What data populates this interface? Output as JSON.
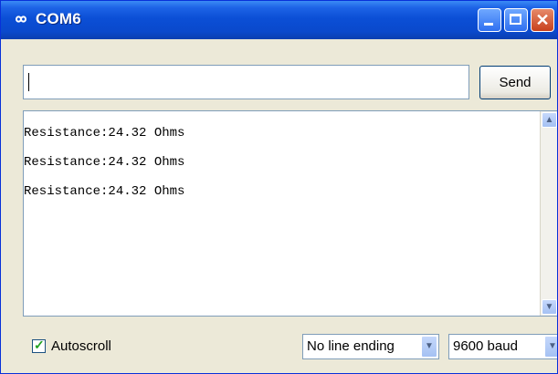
{
  "window": {
    "title": "COM6",
    "app_icon": "infinity-icon",
    "controls": {
      "minimize": "minimize-icon",
      "maximize": "maximize-icon",
      "close": "close-icon",
      "close_glyph": "✕"
    }
  },
  "input": {
    "value": "",
    "placeholder": ""
  },
  "send_button": {
    "label": "Send"
  },
  "output": {
    "lines": [
      "Resistance:24.32 Ohms",
      "Resistance:24.32 Ohms",
      "Resistance:24.32 Ohms"
    ]
  },
  "status_bar": {
    "autoscroll": {
      "label": "Autoscroll",
      "checked": true
    },
    "line_ending": {
      "selected": "No line ending"
    },
    "baud_rate": {
      "selected": "9600 baud"
    }
  },
  "colors": {
    "titlebar": "#0b4fd6",
    "window_bg": "#ece9d8",
    "close_button": "#c8401c"
  }
}
